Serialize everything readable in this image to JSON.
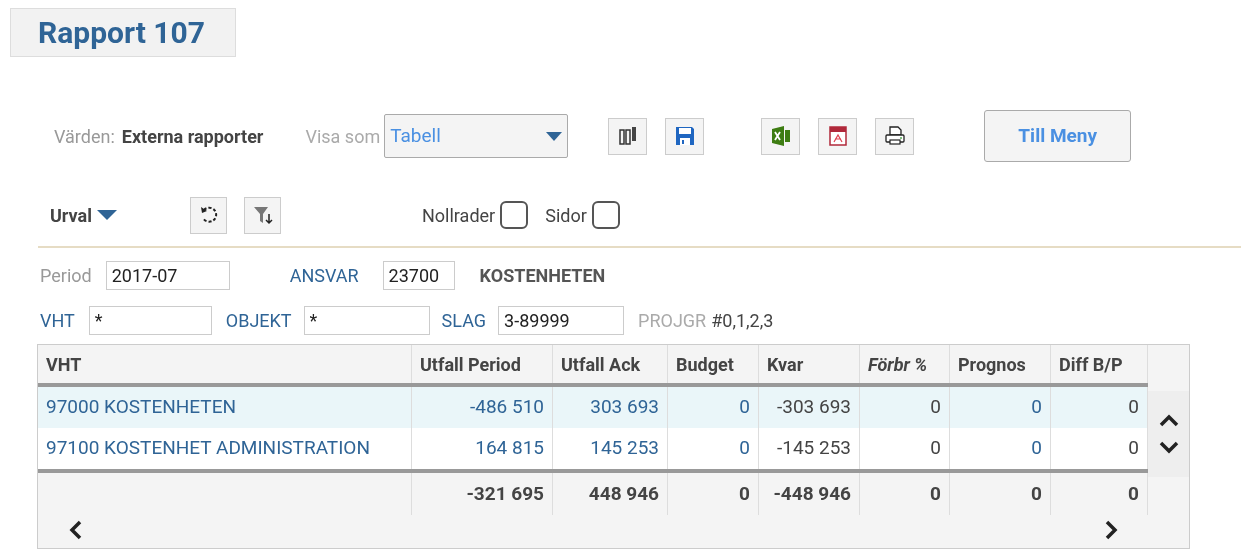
{
  "title": "Rapport 107",
  "toolbar": {
    "values_label": "Värden:",
    "values": "Externa rapporter",
    "view_label": "Visa som",
    "view_select": "Tabell",
    "buttons": [
      {
        "kind": "columns"
      },
      {
        "kind": "save"
      },
      {
        "kind": "excel"
      },
      {
        "kind": "pdf"
      },
      {
        "kind": "print"
      }
    ],
    "menu_button": "Till Meny"
  },
  "selection": {
    "label": "Urval",
    "tools": [
      {
        "kind": "reset"
      },
      {
        "kind": "filter"
      }
    ],
    "checkboxes": [
      {
        "label": "Nollrader",
        "checked": false
      },
      {
        "label": "Sidor",
        "checked": false
      }
    ]
  },
  "filters": {
    "period_label": "Period",
    "period": "2017-07",
    "ansvar_label": "ANSVAR",
    "ansvar": "23700",
    "ansvar_name": "KOSTENHETEN",
    "vht_label": "VHT",
    "vht": "*",
    "objekt_label": "OBJEKT",
    "objekt": "*",
    "slag_label": "SLAG",
    "slag": "3-89999",
    "projgr_label": "PROJGR",
    "projgr": "#0,1,2,3"
  },
  "table": {
    "columns": [
      {
        "label": "VHT",
        "kind": "link",
        "italic": false
      },
      {
        "label": "Utfall Period",
        "kind": "link",
        "italic": false
      },
      {
        "label": "Utfall Ack",
        "kind": "link",
        "italic": false
      },
      {
        "label": "Budget",
        "kind": "link",
        "italic": false
      },
      {
        "label": "Kvar",
        "kind": "plain",
        "italic": false
      },
      {
        "label": "Förbr %",
        "kind": "plain",
        "italic": true
      },
      {
        "label": "Prognos",
        "kind": "link",
        "italic": false
      },
      {
        "label": "Diff B/P",
        "kind": "plain",
        "italic": false
      }
    ],
    "rows": [
      {
        "selected": true,
        "cells": [
          "97000 KOSTENHETEN",
          "-486 510",
          "303 693",
          "0",
          "-303 693",
          "0",
          "0",
          "0"
        ]
      },
      {
        "selected": false,
        "cells": [
          "97100 KOSTENHET ADMINISTRATION",
          "164 815",
          "145 253",
          "0",
          "-145 253",
          "0",
          "0",
          "0"
        ]
      }
    ],
    "totals": [
      "-321 695",
      "448 946",
      "0",
      "-448 946",
      "0",
      "0",
      "0"
    ]
  }
}
